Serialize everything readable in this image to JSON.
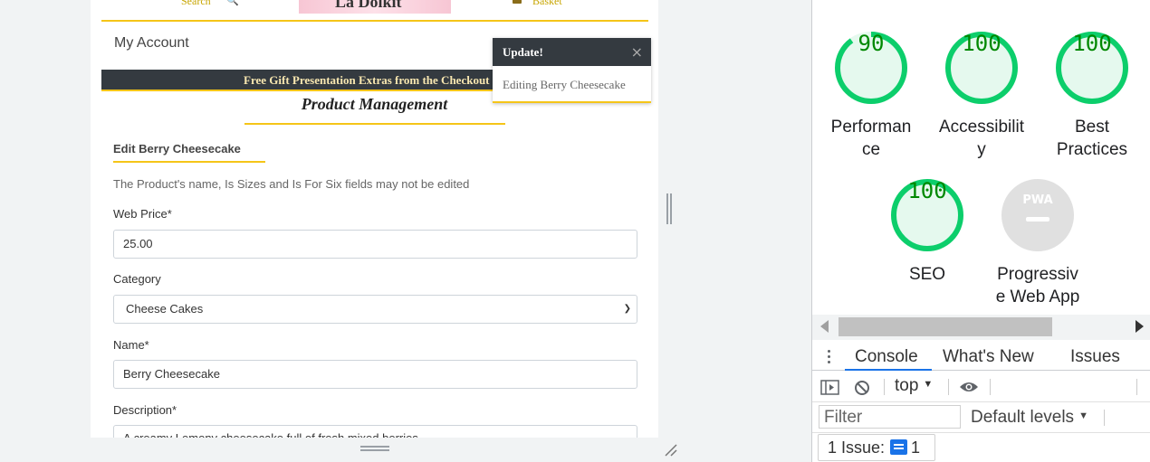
{
  "site": {
    "search_label": "Search",
    "logo_text": "La Dolkit",
    "basket_label": "Basket",
    "my_account": "My Account",
    "promo_text": "Free Gift Presentation Extras from the Checkout",
    "page_title": "Product Management"
  },
  "toast": {
    "title": "Update!",
    "close": "×",
    "message": "Editing Berry Cheesecake"
  },
  "form": {
    "heading": "Edit Berry Cheesecake",
    "help_text": "The Product's name, Is Sizes and Is For Six fields may not be edited",
    "web_price_label": "Web Price*",
    "web_price_value": "25.00",
    "category_label": "Category",
    "category_value": "Cheese Cakes",
    "name_label": "Name*",
    "name_value": "Berry Cheesecake",
    "description_label": "Description*",
    "description_value": "A creamy Lemony cheesecake full of fresh mixed berries"
  },
  "lighthouse": {
    "scores": [
      {
        "label": "Performance",
        "value": "90",
        "color": "#0cce6b"
      },
      {
        "label": "Accessibility",
        "value": "100",
        "color": "#0cce6b"
      },
      {
        "label": "Best Practices",
        "value": "100",
        "color": "#0cce6b"
      },
      {
        "label": "SEO",
        "value": "100",
        "color": "#0cce6b"
      }
    ],
    "pwa": {
      "label": "Progressive Web App",
      "badge": "PWA"
    },
    "perf_fraction": 0.9
  },
  "devtools": {
    "tabs": [
      "Console",
      "What's New",
      "Issues"
    ],
    "context": "top",
    "filter_placeholder": "Filter",
    "levels": "Default levels",
    "issues_label": "1 Issue:",
    "issues_count": "1"
  }
}
